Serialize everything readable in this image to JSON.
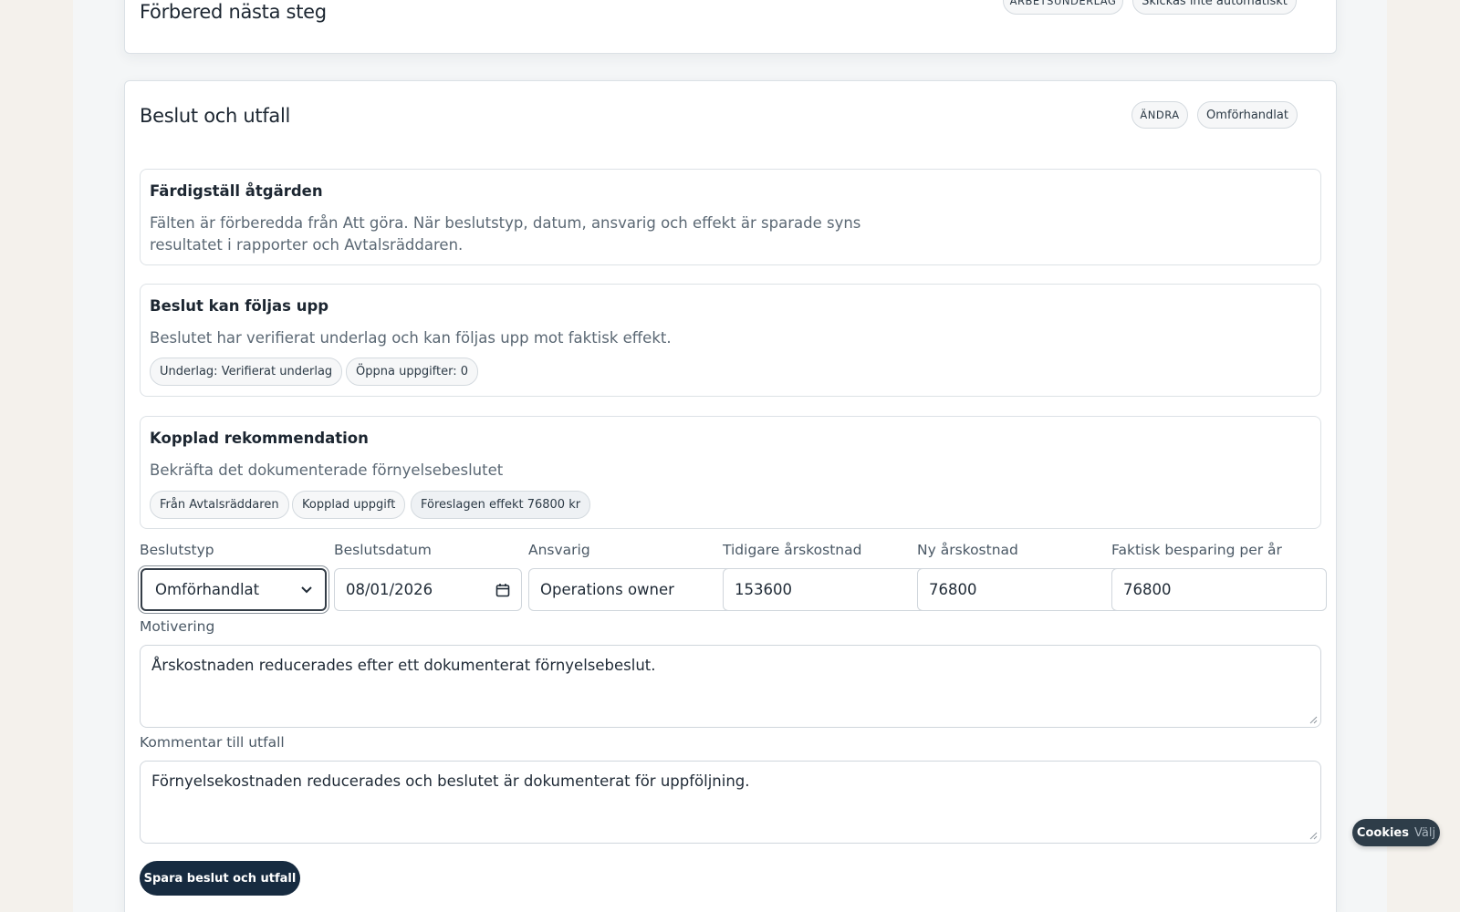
{
  "top_card": {
    "title": "Förbered nästa steg",
    "badge_type": "Arbetsunderlag",
    "badge_status": "Skickas inte automatiskt"
  },
  "main_card": {
    "title": "Beslut och utfall",
    "badge_type": "Ändra",
    "badge_status": "Omförhandlat"
  },
  "finish_box": {
    "title": "Färdigställ åtgärden",
    "text_line1": "Fälten är förberedda från Att göra. När beslutstyp, datum, ansvarig och effekt är sparade syns",
    "text_line2": "resultatet i rapporter och Avtalsräddaren."
  },
  "followup_box": {
    "title": "Beslut kan följas upp",
    "text": "Beslutet har verifierat underlag och kan följas upp mot faktisk effekt.",
    "chips": [
      "Underlag: Verifierat underlag",
      "Öppna uppgifter: 0"
    ]
  },
  "recommendation_box": {
    "title": "Kopplad rekommendation",
    "text": "Bekräfta det dokumenterade förnyelsebeslutet",
    "chips": [
      "Från Avtalsräddaren",
      "Kopplad uppgift",
      "Föreslagen effekt 76800 kr"
    ]
  },
  "fields": {
    "decision_type": {
      "label": "Beslutstyp",
      "value": "Omförhandlat"
    },
    "decision_date": {
      "label": "Beslutsdatum",
      "value": "08/01/2026"
    },
    "responsible": {
      "label": "Ansvarig",
      "value": "Operations owner"
    },
    "previous_cost": {
      "label": "Tidigare årskostnad",
      "value": "153600"
    },
    "new_cost": {
      "label": "Ny årskostnad",
      "value": "76800"
    },
    "actual_saving": {
      "label": "Faktisk besparing per år",
      "value": "76800"
    }
  },
  "motivation": {
    "label": "Motivering",
    "value": "Årskostnaden reducerades efter ett dokumenterat förnyelsebeslut."
  },
  "outcome_comment": {
    "label": "Kommentar till utfall",
    "value": "Förnyelsekostnaden reducerades och beslutet är dokumenterat för uppföljning."
  },
  "save_button": "Spara beslut och utfall",
  "cookie_banner": {
    "label": "Cookies",
    "action": "Välj"
  },
  "colors": {
    "primary_button": "#172b40",
    "page_background": "#f4f6f7",
    "cookie_background": "#2e3d49"
  }
}
